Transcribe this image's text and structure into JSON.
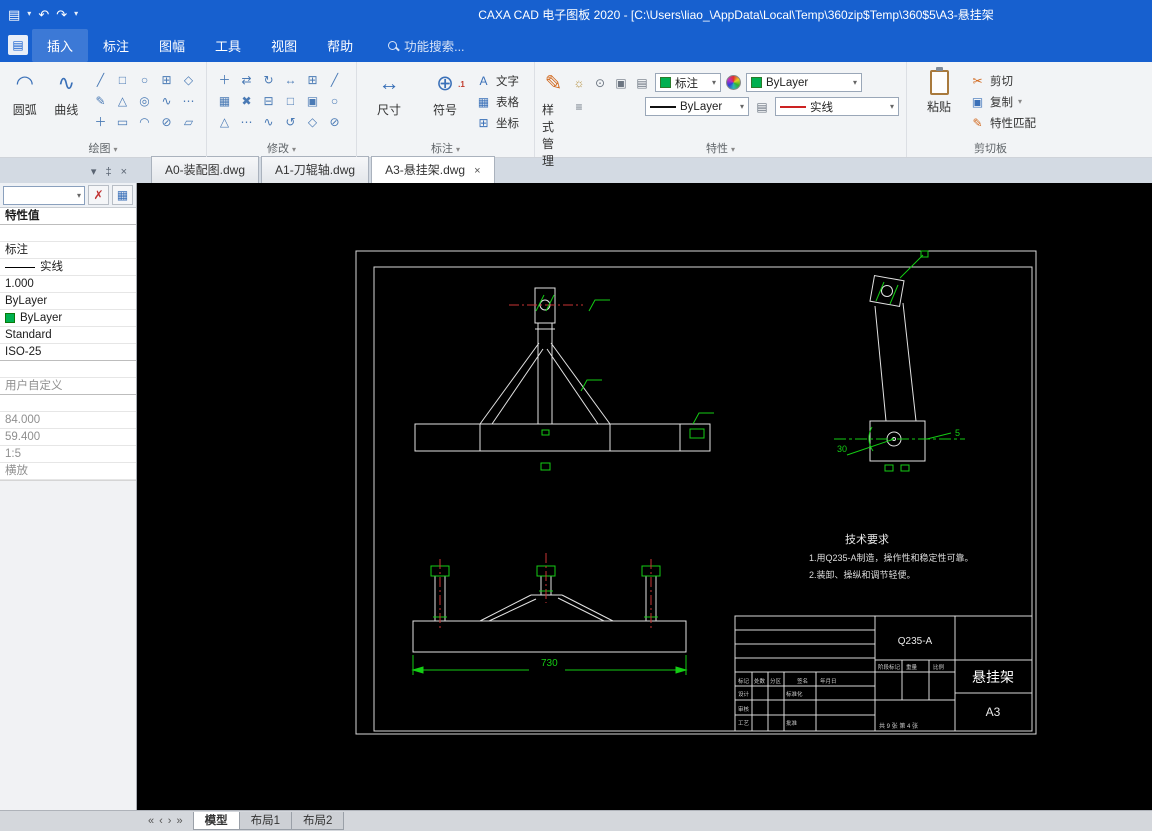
{
  "colors": {
    "titlebar_blue": "#1760cf",
    "canvas_black": "#000000",
    "cad_green": "#14cc14",
    "cad_red": "#c83434",
    "layer_green": "#00b050"
  },
  "titlebar": {
    "title": "CAXA CAD 电子图板 2020 - [C:\\Users\\liao_\\AppData\\Local\\Temp\\360zip$Temp\\360$5\\A3-悬挂架",
    "icons": {
      "printer": "▤",
      "undo": "↶",
      "redo": "↷",
      "dropdown": "▾"
    }
  },
  "menubar": {
    "items": [
      "插入",
      "标注",
      "图幅",
      "工具",
      "视图",
      "帮助"
    ],
    "search_text": "功能搜索..."
  },
  "ribbon": {
    "group_labels": [
      "绘图",
      "修改",
      "标注",
      "特性",
      "剪切板"
    ],
    "draw": {
      "arc": "圆弧",
      "curve": "曲线",
      "grid_icons": [
        "╱",
        "□",
        "○",
        "⊞",
        "◇",
        "✎",
        "△",
        "◎",
        "∿",
        "⋯",
        "＋",
        "▭",
        "◠",
        "⊘",
        "▱"
      ]
    },
    "modify": {
      "grid_icons": [
        "＋",
        "⇄",
        "↻",
        "↔",
        "⊞",
        "╱",
        "▦",
        "✖",
        "⊟",
        "□",
        "▣",
        "○",
        "△",
        "⋯",
        "∿",
        "↺",
        "◇",
        "⊘"
      ]
    },
    "annotate": {
      "dim": "尺寸",
      "symbol": "符号",
      "text": "文字",
      "table": "表格",
      "coord": "坐标"
    },
    "props": {
      "style_manager": "样式管理",
      "layer": "标注",
      "color": "ByLayer",
      "width": "ByLayer",
      "linetype": "实线"
    },
    "clipboard": {
      "paste": "粘贴",
      "cut": "剪切",
      "copy": "复制",
      "match": "特性匹配"
    }
  },
  "doc_tabs": [
    {
      "label": "A0-装配图.dwg"
    },
    {
      "label": "A1-刀辊轴.dwg"
    },
    {
      "label": "A3-悬挂架.dwg"
    }
  ],
  "panel": {
    "header": "特性值",
    "rows": [
      "标注",
      "实线",
      "1.000",
      "ByLayer",
      "ByLayer",
      "Standard",
      "ISO-25",
      "用户自定义",
      "84.000",
      "59.400",
      "1:5",
      "横放"
    ]
  },
  "drawing": {
    "dim_730": "730",
    "dim_30": "30",
    "dim_5": "5",
    "tech_title": "技术要求",
    "tech_line1": "1.用Q235-A制造，操作性和稳定性可靠。",
    "tech_line2": "2.装卸、操纵和调节轻便。",
    "titleblock": {
      "material": "Q235-A",
      "part_name": "悬挂架",
      "sheet": "A3",
      "pages": "共 9 张 第 4 张",
      "labels_row": [
        "标记",
        "处数",
        "分区",
        "签名",
        "年月日"
      ],
      "labels_col": [
        "设计",
        "审核",
        "工艺"
      ],
      "labels_mid": [
        "标准化",
        "批准"
      ],
      "labels_right": [
        "阶段标记",
        "重量",
        "比例"
      ]
    }
  },
  "status": {
    "nav_icons": [
      "«",
      "‹",
      "›",
      "»"
    ],
    "tabs": [
      "模型",
      "布局1",
      "布局2"
    ]
  },
  "ui_icons": {
    "dropdown": "▾",
    "pin": "‡",
    "close": "×",
    "scissors": "✂",
    "pencil": "✎",
    "menu": "≡",
    "grid": "▦",
    "copy": "▣",
    "arrow": "↔",
    "plus_target": "⊕",
    "decimal": ".1",
    "text_a": "A",
    "coord": "⊞",
    "bulb": "☼",
    "target": "⊙",
    "panel": "▣",
    "sheet": "▤",
    "x_red": "✗"
  }
}
